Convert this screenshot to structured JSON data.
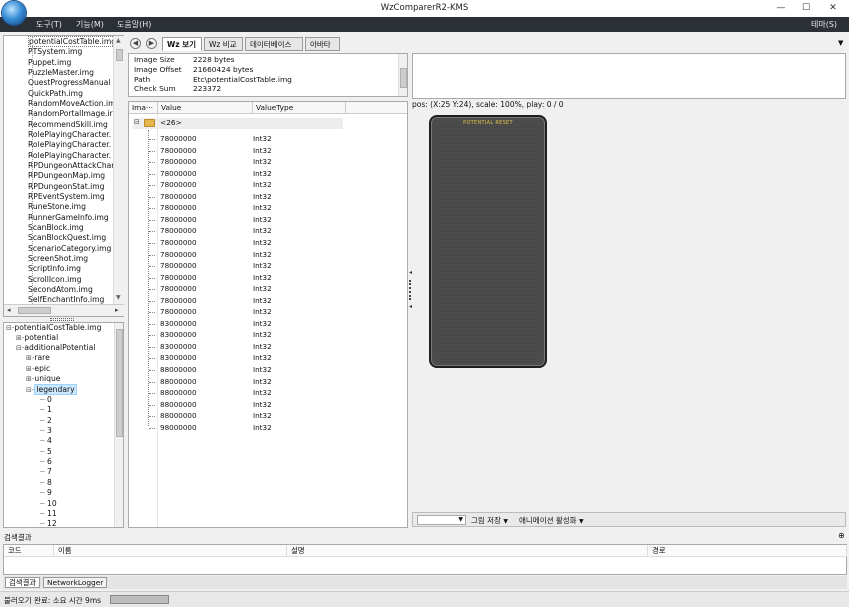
{
  "window": {
    "title": "WzComparerR2-KMS",
    "minimize": "—",
    "maximize": "☐",
    "close": "✕"
  },
  "menu": {
    "items": [
      "도구(T)",
      "기능(M)",
      "도움말(H)"
    ],
    "theme": "테마(S)"
  },
  "file_tree": {
    "items": [
      "potentialCostTable.img",
      "PTSystem.img",
      "Puppet.img",
      "PuzzleMaster.img",
      "QuestProgressManual",
      "QuickPath.img",
      "RandomMoveAction.im",
      "RandomPortalImage.ir",
      "RecommendSkill.img",
      "RolePlayingCharacter.",
      "RolePlayingCharacter.",
      "RolePlayingCharacter.",
      "RPDungeonAttackChar",
      "RPDungeonMap.img",
      "RPDungeonStat.img",
      "RPEventSystem.img",
      "RuneStone.img",
      "RunnerGameInfo.img",
      "ScanBlock.img",
      "ScanBlockQuest.img",
      "ScenarioCategory.img",
      "ScreenShot.img",
      "ScriptInfo.img",
      "ScrollIcon.img",
      "SecondAtom.img",
      "SelfEnchantInfo.img"
    ]
  },
  "node_tree": {
    "root": "potentialCostTable.img",
    "potential": "potential",
    "additional": "additionalPotential",
    "grades": [
      "rare",
      "epic",
      "unique",
      "legendary"
    ],
    "children": [
      "0",
      "1",
      "2",
      "3",
      "4",
      "5",
      "6",
      "7",
      "8",
      "9",
      "10",
      "11",
      "12"
    ]
  },
  "tabs": [
    "Wz 보기",
    "Wz 비교",
    "데이터베이스",
    "아바타"
  ],
  "image_info": {
    "rows": [
      {
        "label": "Image Size",
        "value": "2228 bytes"
      },
      {
        "label": "Image Offset",
        "value": "21660424 bytes"
      },
      {
        "label": "Path",
        "value": "Etc\\potentialCostTable.img"
      },
      {
        "label": "Check Sum",
        "value": "223372"
      }
    ]
  },
  "grid": {
    "headers": [
      "Ima···",
      "Value",
      "ValueType"
    ],
    "folder_label": "<26>",
    "rows": [
      {
        "value": "78000000",
        "type": "Int32"
      },
      {
        "value": "78000000",
        "type": "Int32"
      },
      {
        "value": "78000000",
        "type": "Int32"
      },
      {
        "value": "78000000",
        "type": "Int32"
      },
      {
        "value": "78000000",
        "type": "Int32"
      },
      {
        "value": "78000000",
        "type": "Int32"
      },
      {
        "value": "78000000",
        "type": "Int32"
      },
      {
        "value": "78000000",
        "type": "Int32"
      },
      {
        "value": "78000000",
        "type": "Int32"
      },
      {
        "value": "78000000",
        "type": "Int32"
      },
      {
        "value": "78000000",
        "type": "Int32"
      },
      {
        "value": "78000000",
        "type": "Int32"
      },
      {
        "value": "78000000",
        "type": "Int32"
      },
      {
        "value": "78000000",
        "type": "Int32"
      },
      {
        "value": "78000000",
        "type": "Int32"
      },
      {
        "value": "78000000",
        "type": "Int32"
      },
      {
        "value": "83000000",
        "type": "Int32"
      },
      {
        "value": "83000000",
        "type": "Int32"
      },
      {
        "value": "83000000",
        "type": "Int32"
      },
      {
        "value": "83000000",
        "type": "Int32"
      },
      {
        "value": "88000000",
        "type": "Int32"
      },
      {
        "value": "88000000",
        "type": "Int32"
      },
      {
        "value": "88000000",
        "type": "Int32"
      },
      {
        "value": "88000000",
        "type": "Int32"
      },
      {
        "value": "88000000",
        "type": "Int32"
      },
      {
        "value": "98000000",
        "type": "Int32"
      }
    ]
  },
  "canvas": {
    "status": "pos: (X:25 Y:24), scale: 100%, play: 0 / 0",
    "sprite_label": "POTENTIAL RESET",
    "save_label": "그림 저장",
    "animation_label": "애니메이션 활성화"
  },
  "search": {
    "title": "검색결과",
    "pin": "⊕",
    "columns": [
      "코드",
      "이름",
      "설명",
      "경로"
    ],
    "tabs": [
      "검색결과",
      "NetworkLogger"
    ]
  },
  "status": {
    "text": "불러오기 완료: 소요 시간 9ms"
  },
  "colors": {
    "menubar": "#2b2f36",
    "sprite_bg": "#4b4b4b",
    "selection": "#cce8ff",
    "sprite_text": "#e5c14b"
  }
}
